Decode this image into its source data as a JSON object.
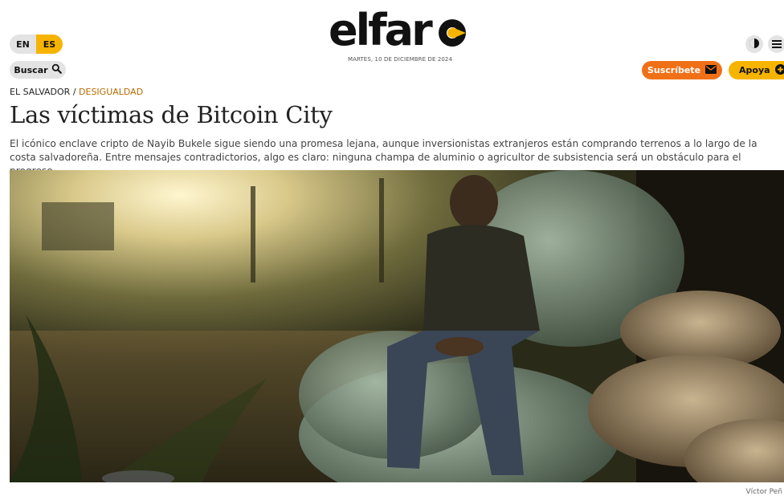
{
  "header": {
    "logo_text": "elfaro",
    "date": "MARTES, 10 DE DICIEMBRE DE 2024",
    "lang": {
      "en": "EN",
      "es": "ES",
      "active": "ES"
    },
    "search_label": "Buscar",
    "subscribe_label": "Suscríbete",
    "support_label": "Apoya",
    "colors": {
      "accent_yellow": "#f6b400",
      "accent_orange": "#f07018"
    },
    "icons": [
      "search-icon",
      "moon-icon",
      "menu-icon",
      "envelope-icon",
      "plus-circle-icon"
    ]
  },
  "article": {
    "section": "EL SALVADOR",
    "category": "DESIGUALDAD",
    "title": "Las víctimas de Bitcoin City",
    "lede": "El icónico enclave cripto de Nayib Bukele sigue siendo una promesa lejana, aunque inversionistas extranjeros están comprando terrenos a lo largo de la costa salvadoreña. Entre mensajes contradictorios, algo es claro: ninguna champa de aluminio o agricultor de subsistencia será un obstáculo para el progreso.",
    "photo_credit": "Víctor Peñ"
  }
}
